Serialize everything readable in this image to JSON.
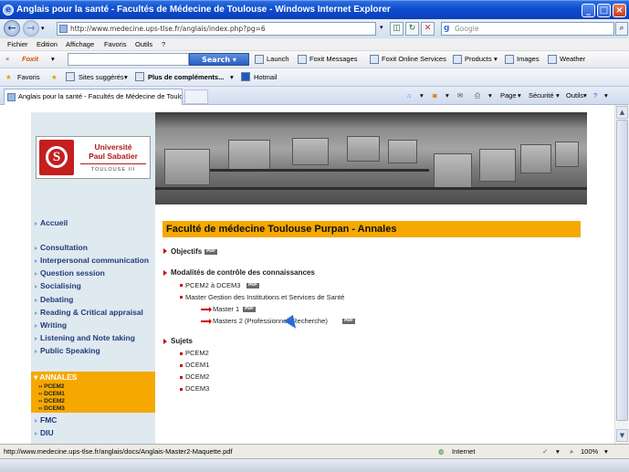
{
  "window": {
    "title": "Anglais pour la santé - Facultés de Médecine de Toulouse - Windows Internet Explorer",
    "address": "http://www.medecine.ups-tlse.fr/anglais/index.php?pg=6",
    "search_placeholder": "Google"
  },
  "menu": [
    "Fichier",
    "Edition",
    "Affichage",
    "Favoris",
    "Outils",
    "?"
  ],
  "foxit": {
    "brand": "Foxit",
    "search_label": "Search",
    "items": [
      "Launch",
      "Foxit Messages",
      "Foxit Online Services",
      "Products",
      "Images",
      "Weather"
    ]
  },
  "favorites": {
    "favorites_label": "Favoris",
    "suggested": "Sites suggérés",
    "more": "Plus de compléments...",
    "hotmail": "Hotmail"
  },
  "tab": {
    "label": "Anglais pour la santé - Facultés de Médecine de Toulo...",
    "tools": [
      "Page",
      "Sécurité",
      "Outils"
    ]
  },
  "logo": {
    "line1": "Université",
    "line2": "Paul Sabatier",
    "line3": "TOULOUSE III"
  },
  "sidebar": {
    "home": "Accueil",
    "items": [
      "Consultation",
      "Interpersonal communication",
      "Question session",
      "Socialising",
      "Debating",
      "Reading & Critical appraisal",
      "Writing",
      "Listening and Note taking",
      "Public Speaking"
    ],
    "annales": {
      "label": "ANNALES",
      "items": [
        "PCEM2",
        "DCEM1",
        "DCEM2",
        "DCEM3"
      ]
    },
    "bottom": [
      "FMC",
      "DIU"
    ]
  },
  "content": {
    "heading": "Faculté de médecine Toulouse Purpan - Annales",
    "objectifs": "Objectifs",
    "modalites": "Modalités de contrôle des connaissances",
    "mod_items": [
      "PCEM2 à DCEM3",
      "Master Gestion des Institutions et Services de Santé"
    ],
    "master_items": [
      "Master 1",
      "Masters 2 (Professionnel, Recherche)"
    ],
    "sujets": "Sujets",
    "sujets_items": [
      "PCEM2",
      "DCEM1",
      "DCEM2",
      "DCEM3"
    ],
    "pdf_label": "PDF"
  },
  "status": {
    "url": "http://www.medecine.ups-tlse.fr/anglais/docs/Anglais-Master2-Maquette.pdf",
    "zone": "Internet",
    "zoom": "100%"
  }
}
